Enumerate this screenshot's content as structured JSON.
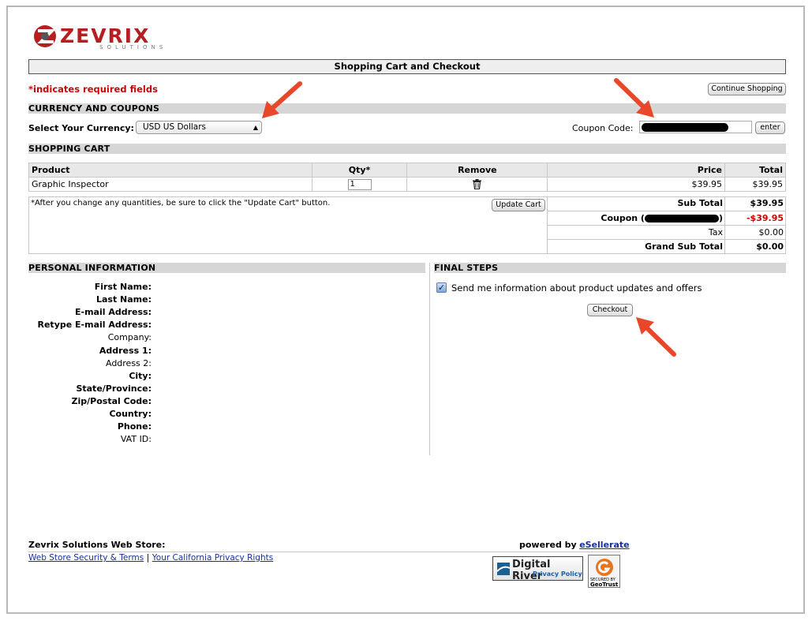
{
  "logo": {
    "word": "ZEVRIX",
    "sub": "SOLUTIONS"
  },
  "title": "Shopping Cart and Checkout",
  "required_note": "*indicates required fields",
  "continue_button": "Continue Shopping",
  "currency_section": {
    "heading": "CURRENCY AND COUPONS",
    "currency_label": "Select Your Currency:",
    "currency_value": "USD US Dollars",
    "coupon_label": "Coupon Code:",
    "enter_button": "enter"
  },
  "cart": {
    "heading": "SHOPPING CART",
    "columns": [
      "Product",
      "Qty*",
      "Remove",
      "Price",
      "Total"
    ],
    "rows": [
      {
        "product": "Graphic Inspector",
        "qty": "1",
        "price": "$39.95",
        "total": "$39.95"
      }
    ],
    "note": "*After you change any quantities, be sure to click the \"Update Cart\" button.",
    "update_button": "Update Cart",
    "totals": {
      "subtotal_label": "Sub Total",
      "subtotal_value": "$39.95",
      "coupon_label": "Coupon (",
      "coupon_close": ")",
      "coupon_value": "-$39.95",
      "tax_label": "Tax",
      "tax_value": "$0.00",
      "grand_label": "Grand Sub Total",
      "grand_value": "$0.00"
    }
  },
  "personal": {
    "heading": "PERSONAL INFORMATION",
    "fields": [
      {
        "label": "First Name:",
        "required": true
      },
      {
        "label": "Last Name:",
        "required": true
      },
      {
        "label": "E-mail Address:",
        "required": true
      },
      {
        "label": "Retype E-mail Address:",
        "required": true
      },
      {
        "label": "Company:",
        "required": false
      },
      {
        "label": "Address 1:",
        "required": true
      },
      {
        "label": "Address 2:",
        "required": false
      },
      {
        "label": "City:",
        "required": true
      },
      {
        "label": "State/Province:",
        "required": true
      },
      {
        "label": "Zip/Postal Code:",
        "required": true
      },
      {
        "label": "Country:",
        "required": true
      },
      {
        "label": "Phone:",
        "required": true
      },
      {
        "label": "VAT ID:",
        "required": false
      }
    ]
  },
  "final_steps": {
    "heading": "FINAL STEPS",
    "opt_in": "Send me information about product updates and offers",
    "opt_in_checked": true,
    "checkout_button": "Checkout"
  },
  "footer": {
    "store": "Zevrix Solutions Web Store:",
    "link1": "Web Store Security & Terms",
    "sep": "|",
    "link2": "Your California Privacy Rights",
    "powered_by": "powered by",
    "powered_link": "eSellerate",
    "dr_badge_1": "Digital River",
    "dr_badge_2": "Privacy Policy",
    "gt_badge_1": "SECURED BY",
    "gt_badge_2": "GeoTrust"
  },
  "colors": {
    "accent": "#cc0000",
    "link": "#1a2f9e",
    "arrow": "#e8472a",
    "section_bg": "#d6d6d6"
  }
}
